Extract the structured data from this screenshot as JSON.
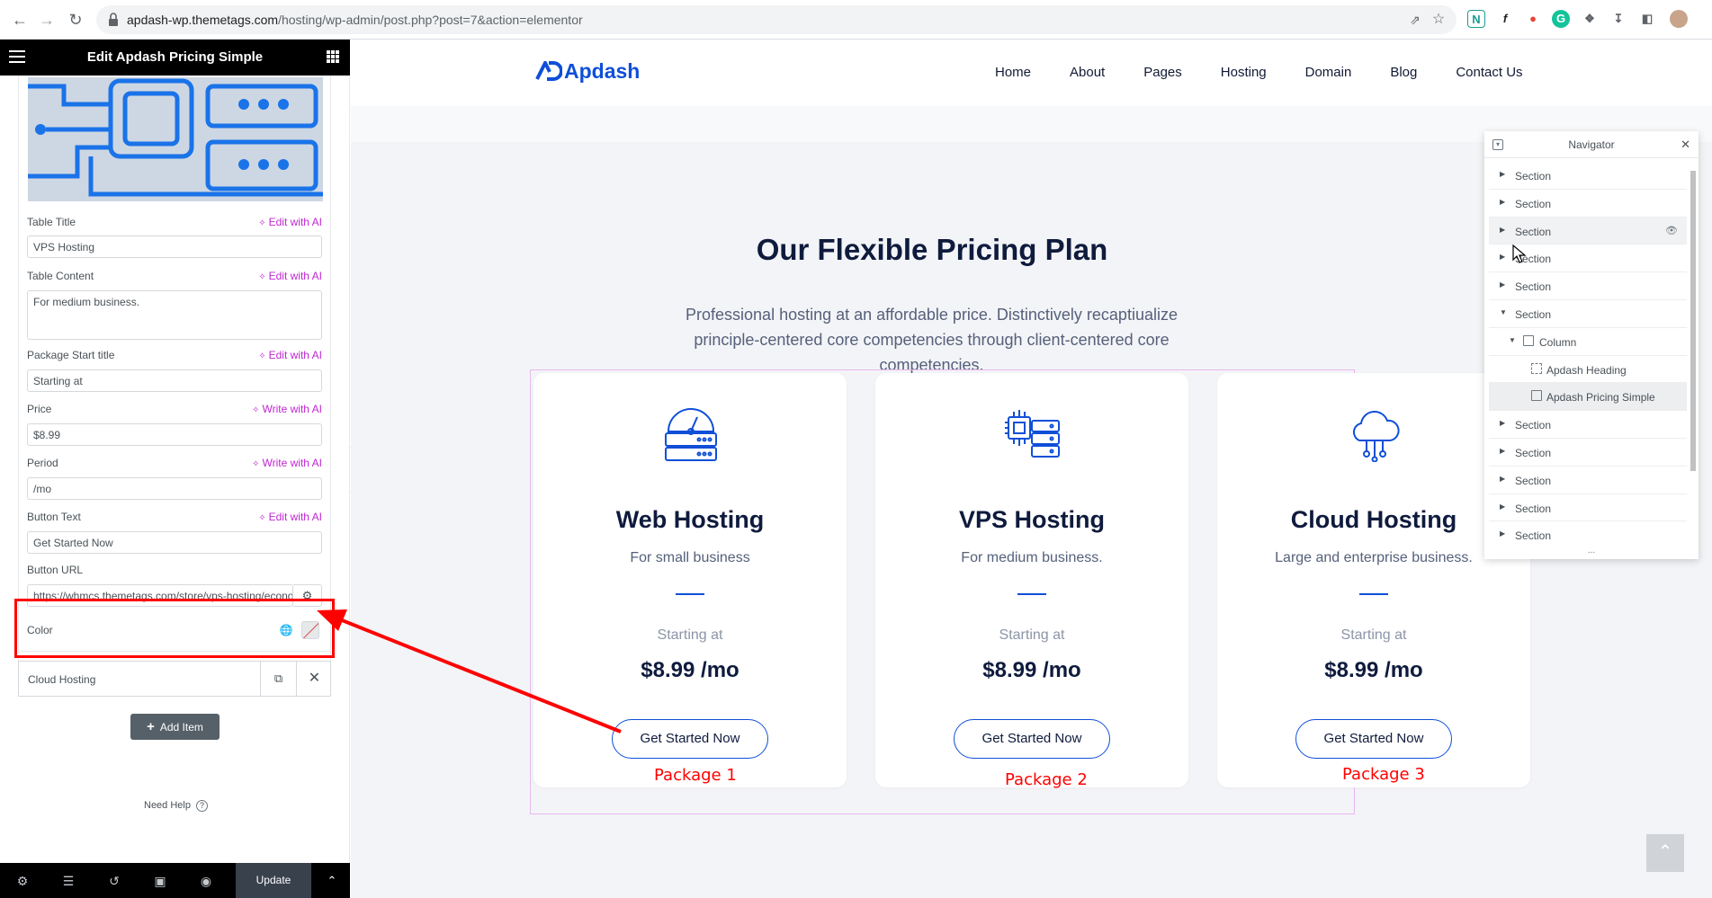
{
  "browser": {
    "url_host": "apdash-wp.themetags.com",
    "url_path": "/hosting/wp-admin/post.php?post=7&action=elementor"
  },
  "editor": {
    "title": "Edit Apdash Pricing Simple",
    "fields": {
      "table_title": {
        "label": "Table Title",
        "value": "VPS Hosting",
        "ai": "Edit with AI"
      },
      "table_content": {
        "label": "Table Content",
        "value": "For medium business.",
        "ai": "Edit with AI"
      },
      "package_start": {
        "label": "Package Start title",
        "value": "Starting at",
        "ai": "Edit with AI"
      },
      "price": {
        "label": "Price",
        "value": "$8.99",
        "ai": "Write with AI"
      },
      "period": {
        "label": "Period",
        "value": "/mo",
        "ai": "Write with AI"
      },
      "button_text": {
        "label": "Button Text",
        "value": "Get Started Now",
        "ai": "Edit with AI"
      },
      "button_url": {
        "label": "Button URL",
        "value": "https://whmcs.themetags.com/store/vps-hosting/economy"
      },
      "color": {
        "label": "Color"
      }
    },
    "repeater_item": "Cloud Hosting",
    "add_item": "Add Item",
    "need_help": "Need Help",
    "update": "Update"
  },
  "site": {
    "logo": "Apdash",
    "nav": [
      "Home",
      "About",
      "Pages",
      "Hosting",
      "Domain",
      "Blog",
      "Contact Us"
    ],
    "section_title": "Our Flexible Pricing Plan",
    "section_desc": "Professional hosting at an affordable price. Distinctively recaptiualize principle-centered core competencies through client-centered core competencies.",
    "cards": [
      {
        "title": "Web Hosting",
        "sub": "For small business",
        "start": "Starting at",
        "price": "$8.99",
        "period": "/mo",
        "button": "Get Started Now",
        "package": "Package 1"
      },
      {
        "title": "VPS Hosting",
        "sub": "For medium business.",
        "start": "Starting at",
        "price": "$8.99",
        "period": "/mo",
        "button": "Get Started Now",
        "package": "Package 2"
      },
      {
        "title": "Cloud Hosting",
        "sub": "Large and enterprise business.",
        "start": "Starting at",
        "price": "$8.99",
        "period": "/mo",
        "button": "Get Started Now",
        "package": "Package 3"
      }
    ]
  },
  "navigator": {
    "title": "Navigator",
    "rows": [
      "Section",
      "Section",
      "Section",
      "Section",
      "Section",
      "Section",
      "Column",
      "Apdash Heading",
      "Apdash Pricing Simple",
      "Section",
      "Section",
      "Section",
      "Section",
      "Section"
    ],
    "more": "..."
  },
  "colors": {
    "brand": "#0f4fd8",
    "ai_accent": "#c026d3",
    "annotation": "#ff0000"
  }
}
